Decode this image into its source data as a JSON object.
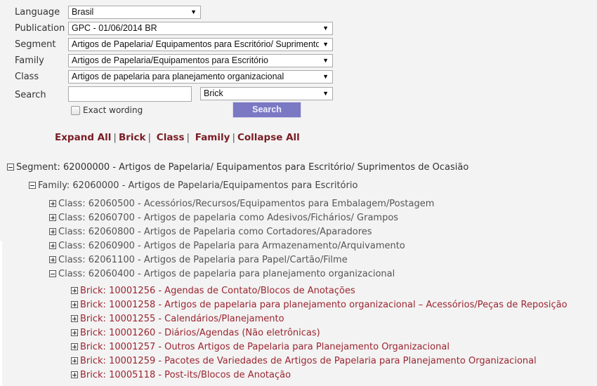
{
  "form": {
    "language": {
      "label": "Language",
      "value": "Brasil"
    },
    "publication": {
      "label": "Publication",
      "value": "GPC - 01/06/2014 BR"
    },
    "segment": {
      "label": "Segment",
      "value": "Artigos de Papelaria/ Equipamentos para Escritório/ Suprimentos de Ocasião"
    },
    "family": {
      "label": "Family",
      "value": "Artigos de Papelaria/Equipamentos para Escritório"
    },
    "class": {
      "label": "Class",
      "value": "Artigos de papelaria para planejamento organizacional"
    },
    "search": {
      "label": "Search",
      "value": "",
      "placeholder": "",
      "level_value": "Brick"
    },
    "exact_wording": {
      "label": "Exact wording",
      "checked": false
    },
    "search_button": "Search",
    "dropdown_arrow": "▼"
  },
  "links": {
    "expand_all": "Expand All",
    "brick": "Brick",
    "class": "Class",
    "family": "Family",
    "collapse_all": "Collapse All",
    "separator": "|"
  },
  "tree": {
    "segment": {
      "text": "Segment: 62000000 - Artigos de Papelaria/ Equipamentos para Escritório/ Suprimentos de Ocasião",
      "expanded": true
    },
    "family": {
      "text": "Family: 62060000 - Artigos de Papelaria/Equipamentos para Escritório",
      "expanded": true
    },
    "classes": [
      {
        "text": "Class: 62060500 - Acessórios/Recursos/Equipamentos para Embalagem/Postagem",
        "expanded": false
      },
      {
        "text": "Class: 62060700 - Artigos de papelaria como Adesivos/Fichários/ Grampos",
        "expanded": false
      },
      {
        "text": "Class: 62060800 - Artigos de Papelaria como Cortadores/Aparadores",
        "expanded": false
      },
      {
        "text": "Class: 62060900 - Artigos de Papelaria para Armazenamento/Arquivamento",
        "expanded": false
      },
      {
        "text": "Class: 62061100 - Artigos de Papelaria para Papel/Cartão/Filme",
        "expanded": false
      },
      {
        "text": "Class: 62060400 - Artigos de papelaria para planejamento organizacional",
        "expanded": true
      }
    ],
    "bricks": [
      {
        "text": "Brick: 10001256 - Agendas de Contato/Blocos de Anotações"
      },
      {
        "text": "Brick: 10001258 - Artigos de papelaria para planejamento organizacional – Acessórios/Peças de Reposição"
      },
      {
        "text": "Brick: 10001255 - Calendários/Planejamento"
      },
      {
        "text": "Brick: 10001260 - Diários/Agendas (Não eletrônicas)"
      },
      {
        "text": "Brick: 10001257 - Outros Artigos de Papelaria para Planejamento Organizacional"
      },
      {
        "text": "Brick: 10001259 - Pacotes de Variedades de Artigos de Papelaria para Planejamento Organizacional"
      },
      {
        "text": "Brick: 10005118 - Post-its/Blocos de Anotação"
      }
    ]
  },
  "colors": {
    "background": "#f3f3f3",
    "link": "#7a1d25",
    "brick_text": "#9b2530",
    "search_button": "#7b78c4"
  }
}
